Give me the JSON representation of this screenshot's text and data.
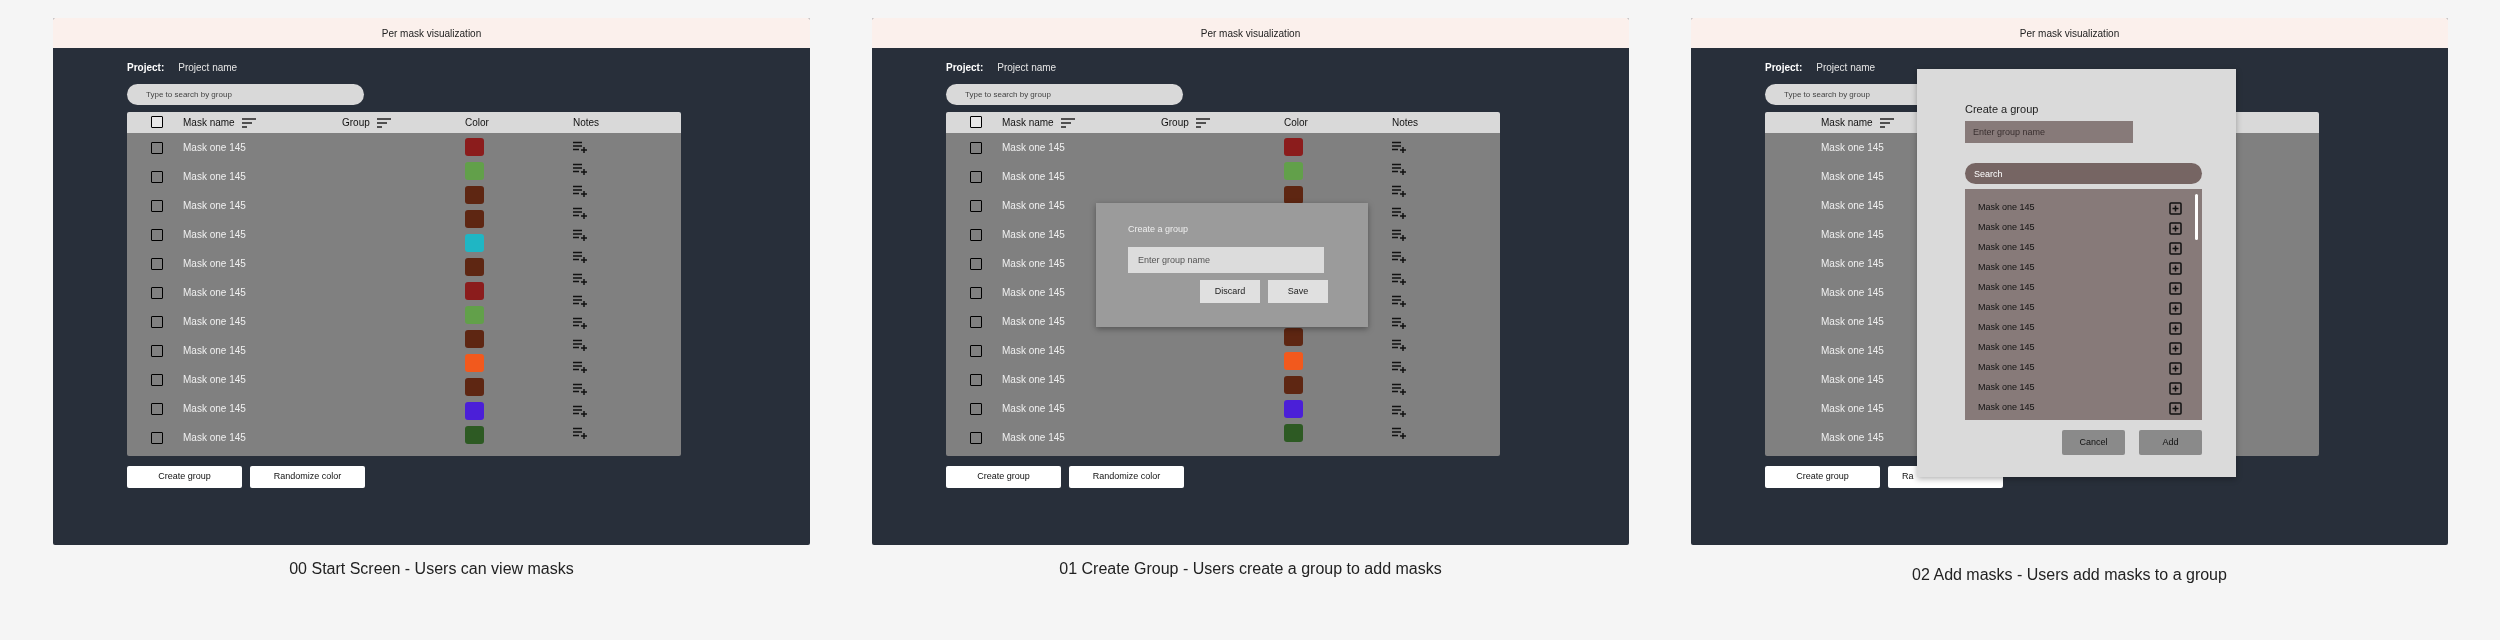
{
  "frames": [
    {
      "header": "Per mask visualization",
      "project_label": "Project:",
      "project_name": "Project name",
      "search_placeholder": "Type to search by group",
      "select_all": {
        "checked": false
      },
      "columns": [
        {
          "kind": "name",
          "label": "Mask name",
          "sortable": true
        },
        {
          "kind": "group",
          "label": "Group",
          "sortable": true
        },
        {
          "kind": "color",
          "label": "Color",
          "sortable": false
        },
        {
          "kind": "notes",
          "label": "Notes",
          "sortable": false
        }
      ],
      "rows": [
        {
          "name": "Mask one 145",
          "checked": false
        },
        {
          "name": "Mask one 145",
          "checked": false
        },
        {
          "name": "Mask one 145",
          "checked": false
        },
        {
          "name": "Mask one 145",
          "checked": false
        },
        {
          "name": "Mask one 145",
          "checked": false
        },
        {
          "name": "Mask one 145",
          "checked": false
        },
        {
          "name": "Mask one 145",
          "checked": false
        },
        {
          "name": "Mask one 145",
          "checked": false
        },
        {
          "name": "Mask one 145",
          "checked": false
        },
        {
          "name": "Mask one 145",
          "checked": false
        },
        {
          "name": "Mask one 145",
          "checked": false
        }
      ],
      "swatch_groups": [
        [
          {
            "color": "#8b1c1c"
          },
          {
            "color": "#62a04a"
          },
          {
            "color": "#5e2612"
          },
          {
            "color": "#5e2612"
          },
          {
            "color": "#1fb6c4"
          },
          {
            "color": "#5e2612"
          },
          {
            "color": "#8b1c1c"
          },
          {
            "color": "#62a04a"
          },
          {
            "color": "#5e2612"
          },
          {
            "color": "#f2591d"
          },
          {
            "color": "#5e2612"
          },
          {
            "color": "#4b1fd8"
          },
          {
            "color": "#2d5a23"
          }
        ]
      ],
      "buttons": [
        "Create group",
        "Randomize color"
      ],
      "caption": "00 Start Screen - Users can view masks"
    },
    {
      "header": "Per mask visualization",
      "project_label": "Project:",
      "project_name": "Project name",
      "search_placeholder": "Type to search by group",
      "select_all": {
        "checked": false
      },
      "columns": [
        {
          "kind": "name",
          "label": "Mask name",
          "sortable": true
        },
        {
          "kind": "group",
          "label": "Group",
          "sortable": true
        },
        {
          "kind": "color",
          "label": "Color",
          "sortable": false
        },
        {
          "kind": "notes",
          "label": "Notes",
          "sortable": false
        }
      ],
      "rows": [
        {
          "name": "Mask one 145",
          "checked": false
        },
        {
          "name": "Mask one 145",
          "checked": false
        },
        {
          "name": "Mask one 145",
          "checked": false
        },
        {
          "name": "Mask one 145",
          "checked": false
        },
        {
          "name": "Mask one 145",
          "checked": false
        },
        {
          "name": "Mask one 145",
          "checked": false
        },
        {
          "name": "Mask one 145",
          "checked": false
        },
        {
          "name": "Mask one 145",
          "checked": false
        },
        {
          "name": "Mask one 145",
          "checked": false
        },
        {
          "name": "Mask one 145",
          "checked": false
        },
        {
          "name": "Mask one 145",
          "checked": false
        }
      ],
      "swatch_groups": [
        [
          {
            "color": "#8b1c1c"
          },
          {
            "color": "#62a04a"
          },
          {
            "color": "#5e2612"
          }
        ],
        [
          {
            "color": "#5e2612"
          },
          {
            "color": "#f2591d"
          },
          {
            "color": "#5e2612"
          },
          {
            "color": "#4b1fd8"
          },
          {
            "color": "#2d5a23"
          }
        ]
      ],
      "buttons": [
        "Create group",
        "Randomize color"
      ],
      "dialog": {
        "kind": "create",
        "title": "Create a group",
        "placeholder": "Enter group name",
        "buttons": [
          "Discard",
          "Save"
        ]
      },
      "caption": "01 Create Group - Users create a group to add masks"
    },
    {
      "header": "Per mask visualization",
      "project_label": "Project:",
      "project_name": "Project name",
      "search_placeholder": "Type to search by group",
      "columns": [
        {
          "kind": "name",
          "label": "Mask name",
          "sortable": true
        }
      ],
      "rows": [
        {
          "name": "Mask one 145"
        },
        {
          "name": "Mask one 145"
        },
        {
          "name": "Mask one 145"
        },
        {
          "name": "Mask one 145"
        },
        {
          "name": "Mask one 145"
        },
        {
          "name": "Mask one 145"
        },
        {
          "name": "Mask one 145"
        },
        {
          "name": "Mask one 145"
        },
        {
          "name": "Mask one 145"
        },
        {
          "name": "Mask one 145"
        },
        {
          "name": "Mask one 145"
        }
      ],
      "buttons": [
        "Create group",
        "Ra"
      ],
      "dialog": {
        "kind": "add",
        "title": "Create a group",
        "placeholder": "Enter group name",
        "search_placeholder": "Search",
        "items": [
          "Mask one 145",
          "Mask one 145",
          "Mask one 145",
          "Mask one 145",
          "Mask one 145",
          "Mask one 145",
          "Mask one 145",
          "Mask one 145",
          "Mask one 145",
          "Mask one 145",
          "Mask one 145"
        ],
        "buttons": [
          "Cancel",
          "Add"
        ]
      },
      "caption": "02 Add masks - Users add masks to a group"
    }
  ]
}
